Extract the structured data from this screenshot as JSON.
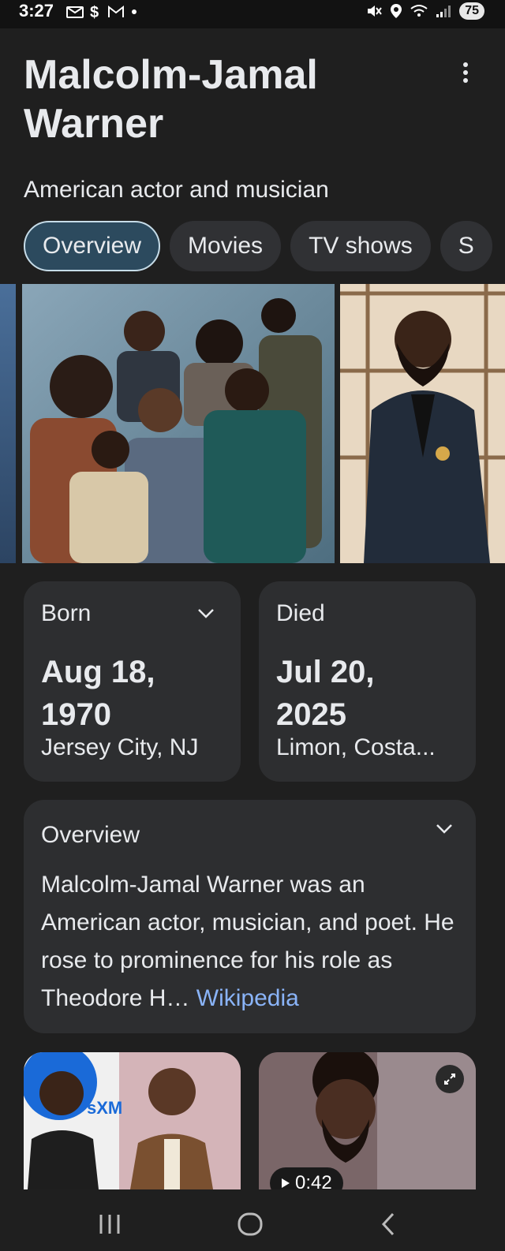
{
  "status_bar": {
    "time": "3:27",
    "battery": "75"
  },
  "entity": {
    "name": "Malcolm-Jamal Warner",
    "description": "American actor and musician"
  },
  "tabs": [
    {
      "label": "Overview",
      "active": true
    },
    {
      "label": "Movies"
    },
    {
      "label": "TV shows"
    },
    {
      "label": "S"
    }
  ],
  "born": {
    "label": "Born",
    "date_line1": "Aug 18,",
    "date_line2": "1970",
    "place": "Jersey City, NJ"
  },
  "died": {
    "label": "Died",
    "date_line1": "Jul 20,",
    "date_line2": "2025",
    "place": "Limon, Costa..."
  },
  "overview": {
    "title": "Overview",
    "text": "Malcolm-Jamal Warner was an American actor, musician, and poet. He rose to prominence for his role as Theodore H… ",
    "source": "Wikipedia"
  },
  "media": {
    "video_duration": "0:42",
    "logo_text": "sXM"
  },
  "colors": {
    "background": "#1f1f1f",
    "card": "#2d2e30",
    "active_tab": "#2c4a5e",
    "link": "#8ab4f8"
  }
}
